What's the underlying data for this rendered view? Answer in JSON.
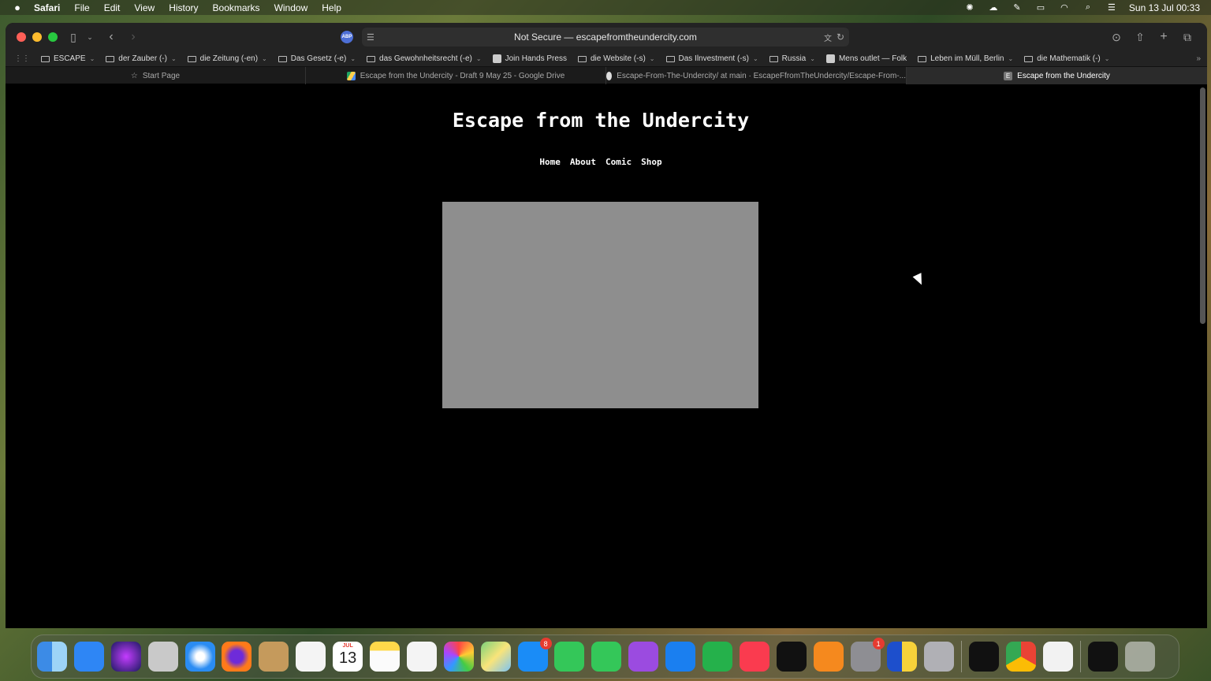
{
  "menubar": {
    "app": "Safari",
    "items": [
      "File",
      "Edit",
      "View",
      "History",
      "Bookmarks",
      "Window",
      "Help"
    ],
    "clock": "Sun 13 Jul  00:33",
    "status_icons": [
      "chatgpt-icon",
      "creative-cloud-icon",
      "pen-icon",
      "display-icon",
      "wifi-icon",
      "spotlight-icon",
      "control-center-icon"
    ]
  },
  "browser": {
    "address": "Not Secure — escapefromtheundercity.com",
    "abp_label": "ABP",
    "bookmarks": [
      {
        "label": "ESCAPE",
        "type": "folder"
      },
      {
        "label": "der Zauber (-)",
        "type": "folder"
      },
      {
        "label": "die Zeitung (-en)",
        "type": "folder"
      },
      {
        "label": "Das Gesetz (-e)",
        "type": "folder"
      },
      {
        "label": "das Gewohnheitsrecht (-e)",
        "type": "folder"
      },
      {
        "label": "Join Hands Press",
        "type": "link"
      },
      {
        "label": "die Website (-s)",
        "type": "folder"
      },
      {
        "label": "Das Ilnvestment (-s)",
        "type": "folder"
      },
      {
        "label": "Russia",
        "type": "folder"
      },
      {
        "label": "Mens outlet — Folk",
        "type": "link"
      },
      {
        "label": "Leben im Müll, Berlin",
        "type": "folder"
      },
      {
        "label": "die Mathematik (-)",
        "type": "folder"
      }
    ],
    "tabs": [
      {
        "label": "Start Page",
        "active": false
      },
      {
        "label": "Escape from the Undercity - Draft 9 May 25 - Google Drive",
        "active": false
      },
      {
        "label": "Escape-From-The-Undercity/ at main · EscapeFfromTheUndercity/Escape-From-...",
        "active": false
      },
      {
        "label": "Escape from the Undercity",
        "active": true
      }
    ],
    "active_tab_favicon_letter": "E"
  },
  "page": {
    "title": "Escape from the Undercity",
    "nav": [
      "Home",
      "About",
      "Comic",
      "Shop"
    ]
  },
  "dock": {
    "calendar_month": "JUL",
    "calendar_day": "13",
    "appstore_badge": "8",
    "settings_badge": "1",
    "apps": [
      "finder",
      "mail",
      "siri",
      "launchpad",
      "safari",
      "firefox",
      "contacts",
      "reminders",
      "calendar",
      "notes",
      "freeform",
      "photos",
      "maps",
      "app-store",
      "facetime",
      "messages",
      "podcasts",
      "keynote",
      "numbers",
      "music",
      "apple-tv",
      "books",
      "system-settings",
      "app-generic",
      "iphone-mirroring",
      "chatgpt",
      "chrome",
      "textedit",
      "html-file",
      "trash"
    ]
  }
}
